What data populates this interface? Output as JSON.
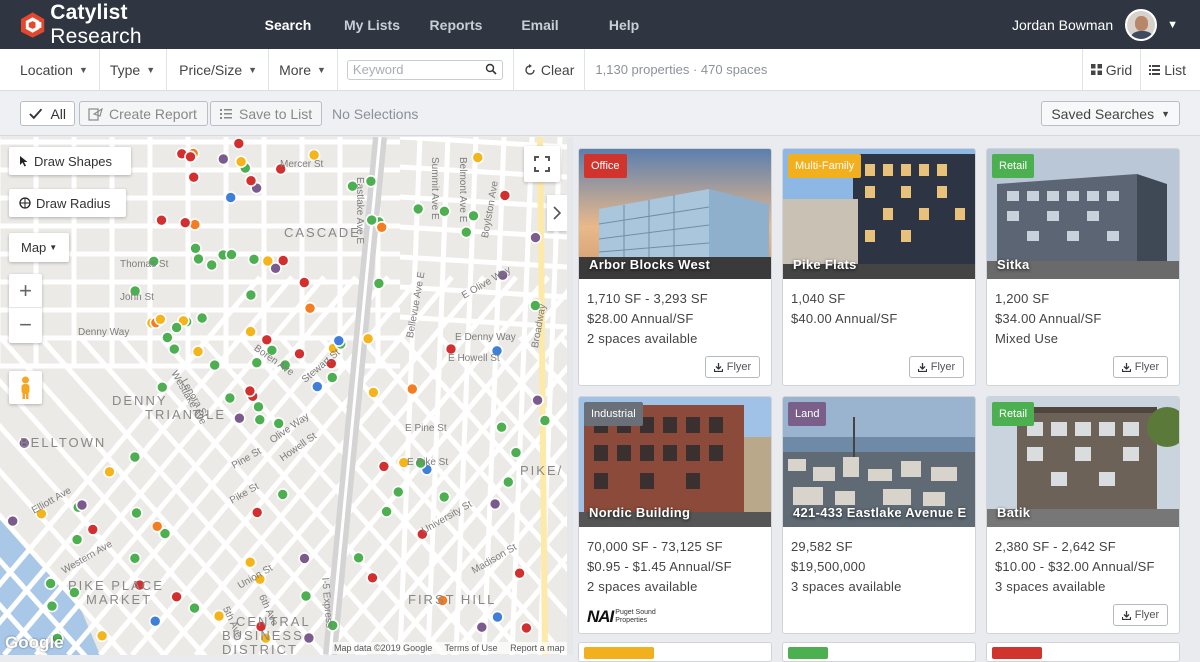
{
  "app": {
    "brand_bold": "Catylist",
    "brand_light": " Research"
  },
  "nav": [
    {
      "label": "Search",
      "active": true
    },
    {
      "label": "My Lists"
    },
    {
      "label": "Reports"
    },
    {
      "label": "Email"
    },
    {
      "label": "Help"
    }
  ],
  "user": {
    "name": "Jordan Bowman"
  },
  "filters": {
    "location": "Location",
    "type": "Type",
    "price_size": "Price/Size",
    "more": "More",
    "keyword_placeholder": "Keyword",
    "clear": "Clear",
    "count": "1,130 properties · 470 spaces",
    "grid": "Grid",
    "list": "List"
  },
  "actions": {
    "all": "All",
    "create_report": "Create Report",
    "save_to_list": "Save to List",
    "no_selections": "No Selections",
    "saved_searches": "Saved Searches"
  },
  "map": {
    "draw_shapes": "Draw Shapes",
    "draw_radius": "Draw Radius",
    "map_type": "Map",
    "zoom_in": "+",
    "zoom_out": "−",
    "google": "Google",
    "attribution": [
      "Map data ©2019 Google",
      "Terms of Use",
      "Report a map error"
    ],
    "labels": [
      "CASCADE",
      "DENNY",
      "TRIANGLE",
      "BELLTOWN",
      "PIKE PLACE",
      "MARKET",
      "CENTRAL",
      "BUSINESS",
      "DISTRICT",
      "FIRST HILL",
      "PIKE/",
      "Mercer St",
      "Thomas St",
      "John St",
      "Denny Way",
      "Boren Ave",
      "Westlake Ave",
      "Stewart St",
      "Olive Way",
      "Pine St",
      "Pike St",
      "Union St",
      "Madison St",
      "Elliott Ave",
      "Western Ave",
      "I-5 Express",
      "Eastlake Ave E",
      "Bellevue Ave E",
      "E Olive Way",
      "E Denny Way",
      "E Howell St",
      "E Pine St",
      "E Pike St",
      "Broadway",
      "Boylston Ave",
      "Summit Ave E",
      "Belmont Ave E",
      "University St",
      "6th Ave",
      "5th Ave",
      "Lenora St",
      "Howell St"
    ],
    "marker_colors": {
      "green": "#4caf50",
      "red": "#d32f2f",
      "purple": "#7b5b8e",
      "orange": "#f57c20",
      "blue": "#3f7fd9",
      "yellow": "#f4b41a"
    }
  },
  "cards": [
    {
      "tag": "Office",
      "tag_color": "#d0342c",
      "title": "Arbor Blocks West",
      "lines": [
        "1,710 SF - 3,293 SF",
        "$28.00 Annual/SF",
        "2 spaces available"
      ],
      "flyer": "Flyer"
    },
    {
      "tag": "Multi-Family",
      "tag_color": "#f2b01e",
      "title": "Pike Flats",
      "lines": [
        "1,040 SF",
        "$40.00 Annual/SF",
        ""
      ],
      "flyer": "Flyer"
    },
    {
      "tag": "Retail",
      "tag_color": "#4caf50",
      "title": "Sitka",
      "lines": [
        "1,200 SF",
        "$34.00 Annual/SF",
        "Mixed Use"
      ],
      "flyer": "Flyer"
    },
    {
      "tag": "Industrial",
      "tag_color": "#6a6f78",
      "title": "Nordic Building",
      "lines": [
        "70,000 SF - 73,125 SF",
        "$0.95 - $1.45 Annual/SF",
        "2 spaces available"
      ],
      "broker_logo": "NAI",
      "broker_text": [
        "Puget Sound",
        "Properties"
      ]
    },
    {
      "tag": "Land",
      "tag_color": "#7a5f8a",
      "title": "421-433 Eastlake Avenue E",
      "lines": [
        "29,582 SF",
        "$19,500,000",
        "3 spaces available"
      ]
    },
    {
      "tag": "Retail",
      "tag_color": "#4caf50",
      "title": "Batik",
      "lines": [
        "2,380 SF - 2,642 SF",
        "$10.00 - $32.00 Annual/SF",
        "3 spaces available"
      ],
      "flyer": "Flyer"
    }
  ]
}
